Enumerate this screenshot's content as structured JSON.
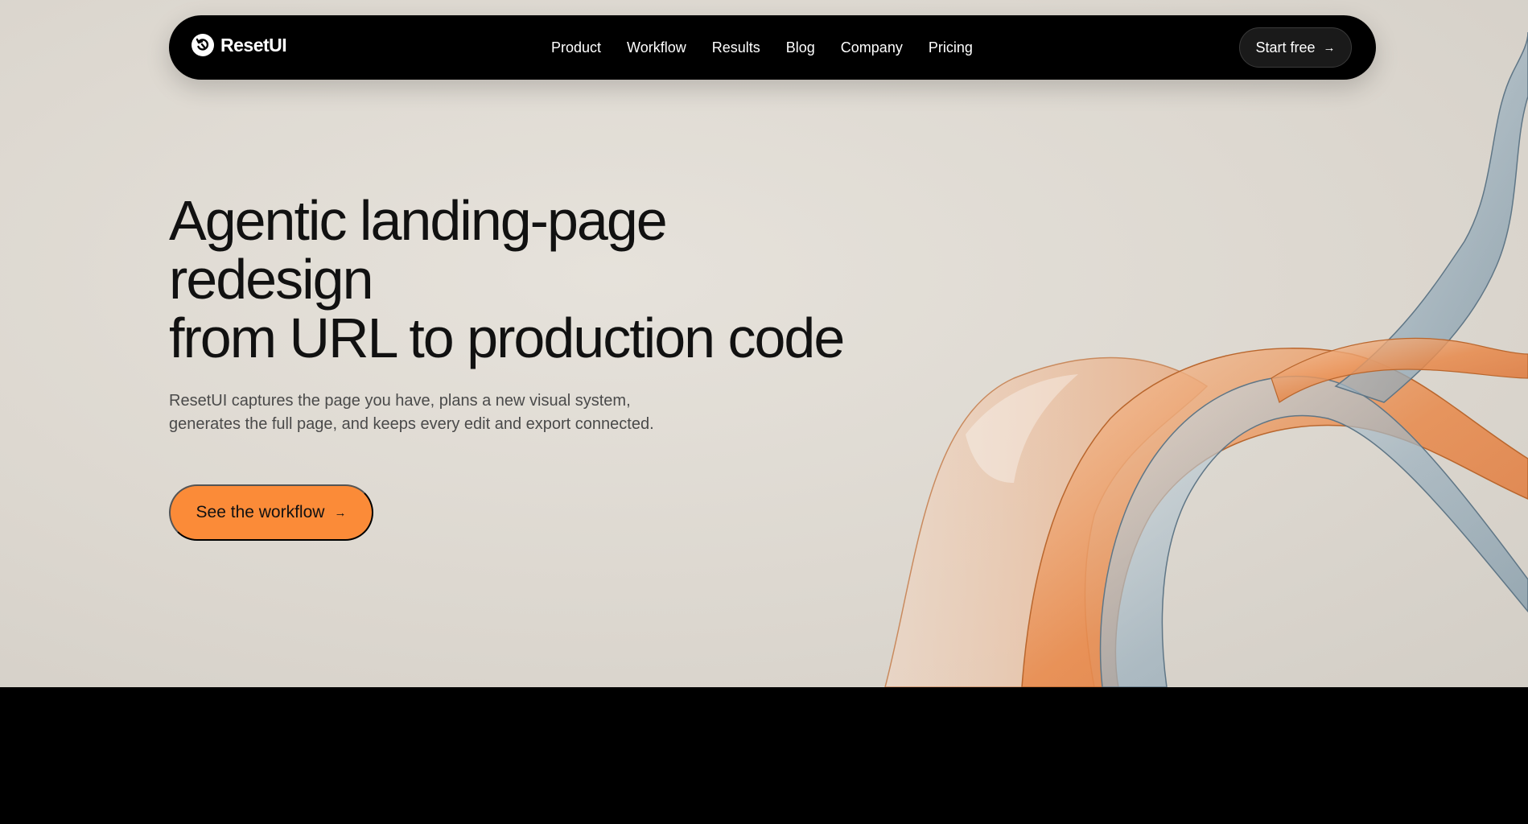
{
  "brand": {
    "name": "ResetUI",
    "icon": "reset-logo-icon"
  },
  "nav": {
    "links": [
      "Product",
      "Workflow",
      "Results",
      "Blog",
      "Company",
      "Pricing"
    ],
    "cta_label": "Start free",
    "cta_icon": "arrow-right-icon"
  },
  "hero": {
    "headline_lines": [
      "Agentic landing-page",
      "redesign",
      "from URL to production code"
    ],
    "subtext": "ResetUI captures the page you have, plans a new visual system, generates the full page, and keeps every edit and export connected.",
    "cta_label": "See the workflow",
    "cta_icon": "arrow-right-icon"
  },
  "colors": {
    "accent": "#fb8b38",
    "nav_bg": "#000000",
    "hero_bg": "#dcd7cf",
    "ribbon_orange": "#e8894a",
    "ribbon_blue": "#9fb3c0"
  }
}
